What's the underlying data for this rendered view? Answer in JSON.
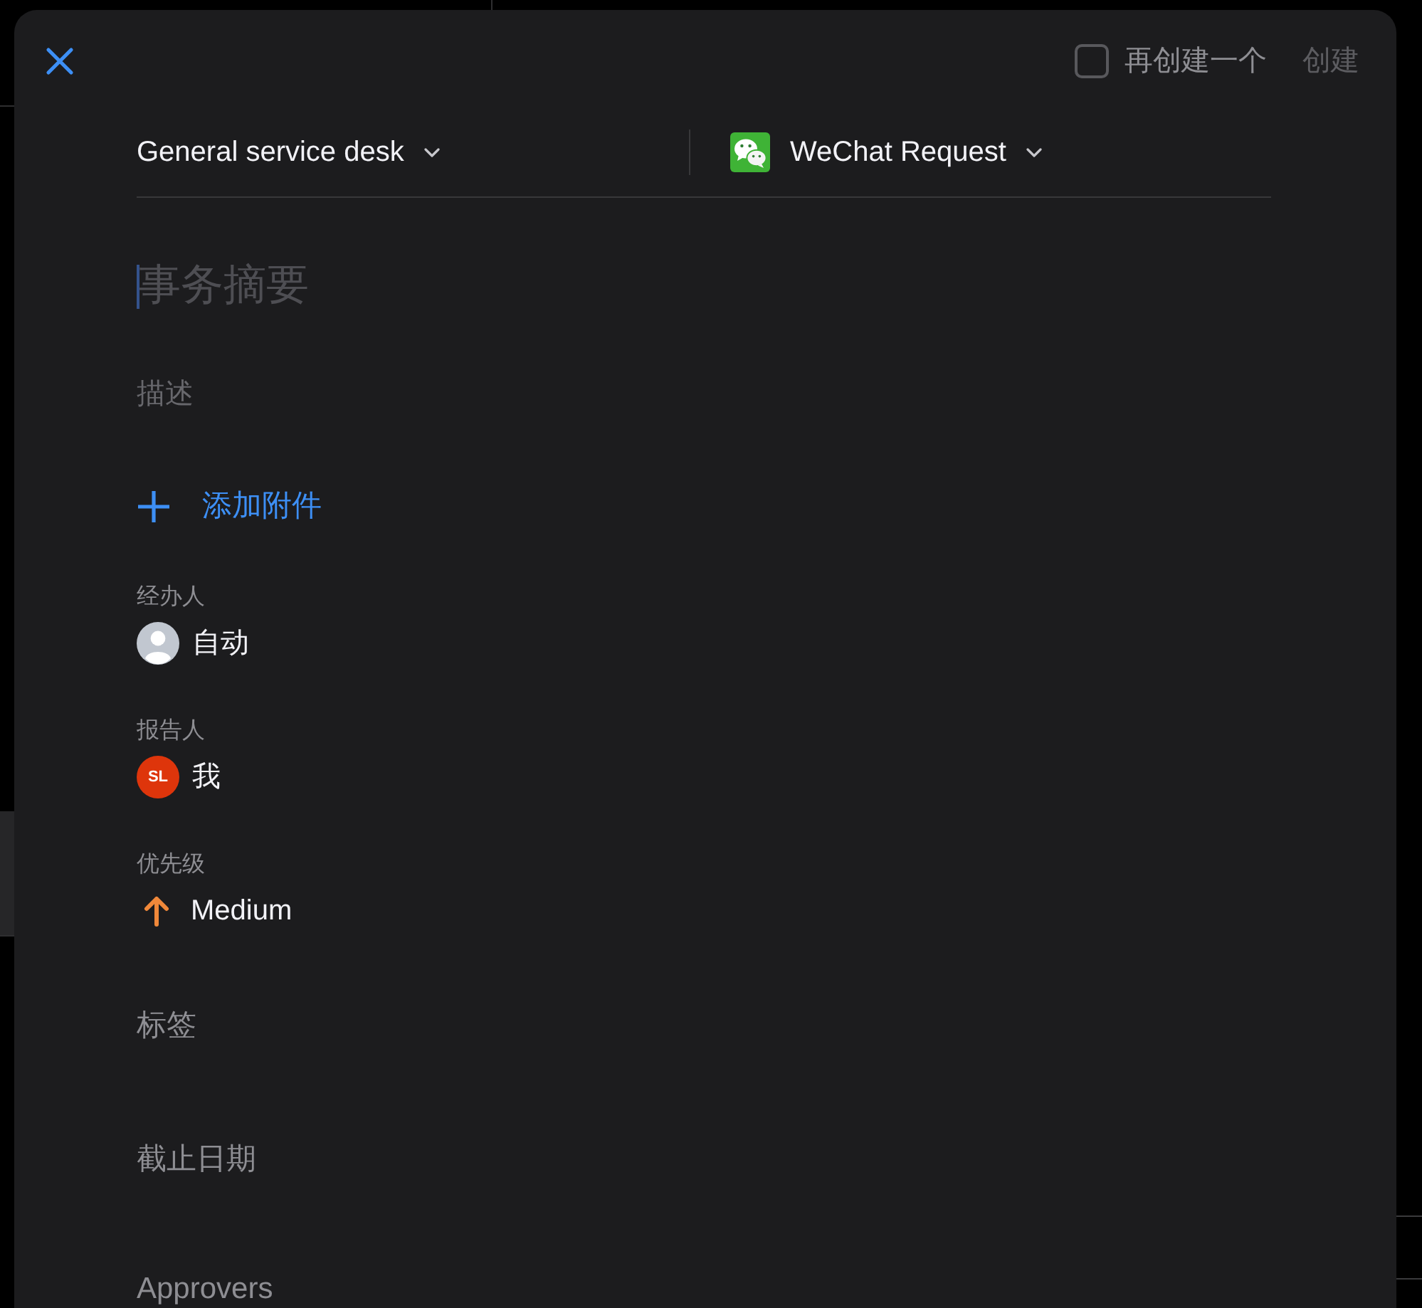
{
  "top_bar": {
    "create_another": {
      "label": "再创建一个",
      "checked": false
    },
    "create_button": {
      "label": "创建",
      "disabled": true
    }
  },
  "header": {
    "project": {
      "label": "General service desk"
    },
    "request_type": {
      "label": "WeChat Request"
    }
  },
  "summary": {
    "placeholder": "事务摘要",
    "focused": true
  },
  "description": {
    "placeholder": "描述"
  },
  "attachment": {
    "label": "添加附件"
  },
  "fields": [
    {
      "kind": "user",
      "label": "经办人",
      "value": "自动",
      "avatar": {
        "kind": "silhouette"
      }
    },
    {
      "kind": "user",
      "label": "报告人",
      "value": "我",
      "avatar": {
        "kind": "initials",
        "initials": "SL",
        "color": "#de350b"
      }
    },
    {
      "kind": "priority",
      "label": "优先级",
      "value": "Medium"
    },
    {
      "kind": "text",
      "label": "标签"
    },
    {
      "kind": "text",
      "label": "截止日期"
    },
    {
      "kind": "text",
      "label": "Approvers"
    }
  ]
}
